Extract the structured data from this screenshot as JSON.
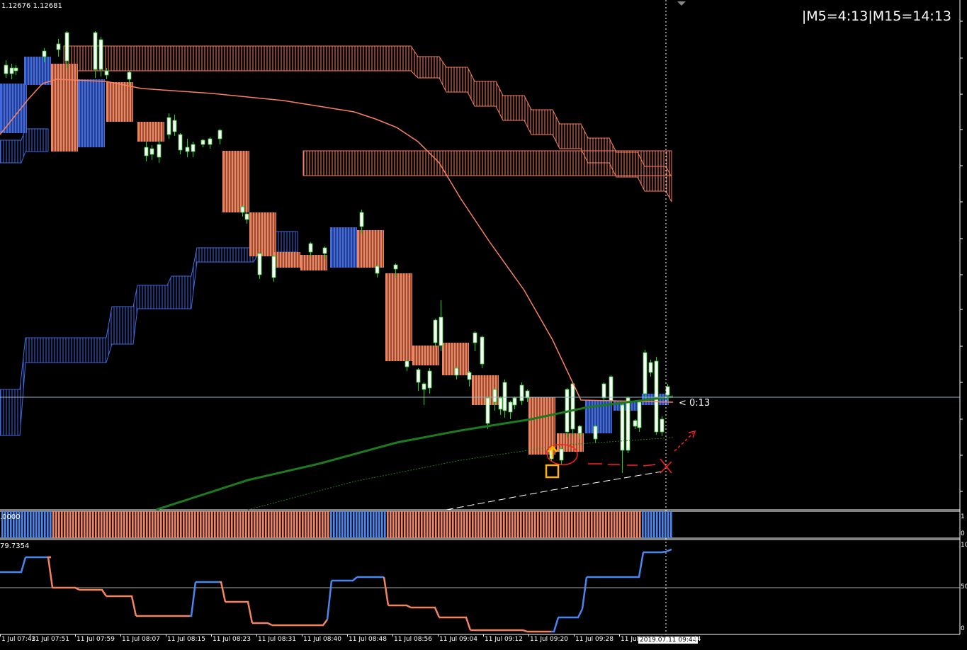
{
  "main_chart": {
    "header": "1.12676 1.12681",
    "timer": "|M5=4:13|M15=14:13",
    "countdown": "< 0:13"
  },
  "indicator1": {
    "label": ".0000",
    "scale_top": "1",
    "scale_bottom": "0"
  },
  "indicator2": {
    "label": "79.7354",
    "scale_top": "10",
    "scale_mid": "50",
    "scale_bottom": "0"
  },
  "time_axis": {
    "labels": [
      "1 Jul 07:43",
      "11 Jul 07:51",
      "11 Jul 07:59",
      "11 Jul 08:07",
      "11 Jul 08:15",
      "11 Jul 08:23",
      "11 Jul 08:31",
      "11 Jul 08:40",
      "11 Jul 08:48",
      "11 Jul 08:56",
      "11 Jul 09:04",
      "11 Jul 09:12",
      "11 Jul 09:20",
      "11 Jul 09:28",
      "11 Jul"
    ],
    "cursor_time": "2019.07.11 09:44",
    "trailing": "44"
  },
  "colors": {
    "background": "#000000",
    "bull_block": "#4169e1",
    "bear_block": "#f4845f",
    "candle_bull": "#ffffff",
    "candle_wick": "#22cc22",
    "ma_salmon": "#fa8060",
    "ma_green": "#1e7a1e",
    "annotation_red": "#ff2020",
    "marker_yellow": "#ffb000"
  }
}
